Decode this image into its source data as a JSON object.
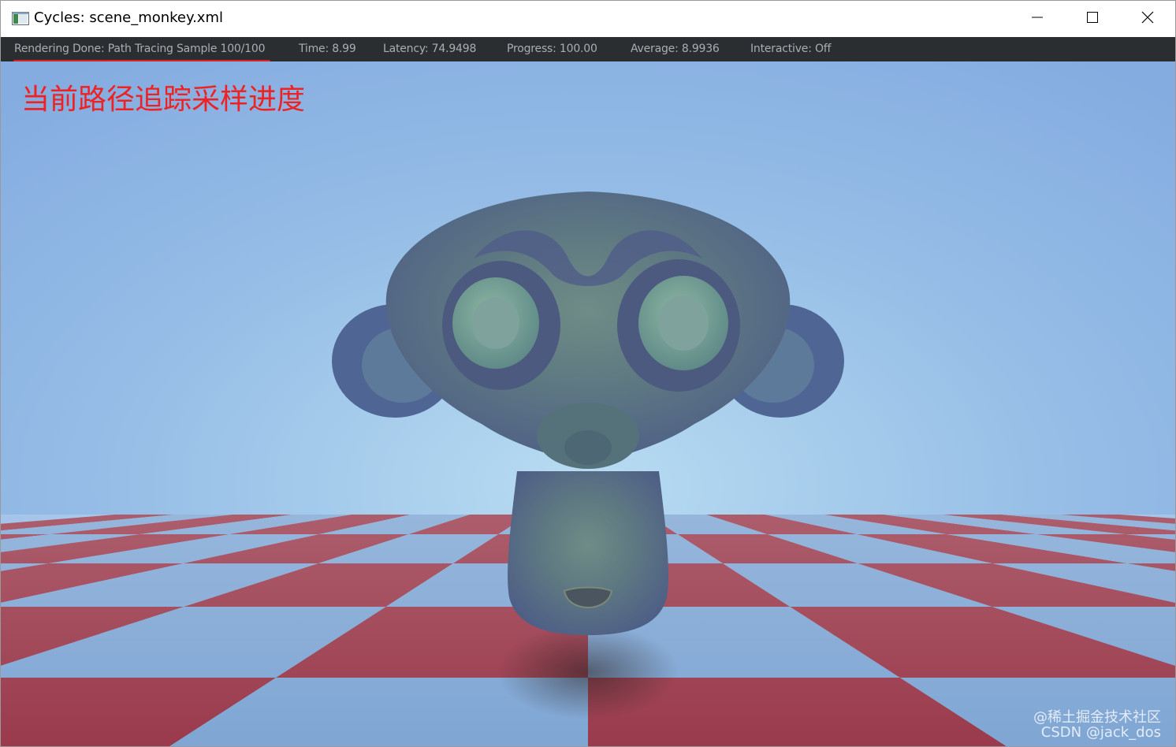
{
  "window": {
    "title": "Cycles: scene_monkey.xml",
    "icon": "app-window-icon",
    "controls": {
      "minimize": "minimize-icon",
      "maximize": "maximize-icon",
      "close": "close-icon"
    }
  },
  "status_bar": {
    "status": "Rendering Done: Path Tracing Sample 100/100",
    "time": "Time: 8.99",
    "latency": "Latency: 74.9498",
    "progress": "Progress: 100.00",
    "average": "Average: 8.9936",
    "interactive": "Interactive: Off",
    "highlight_color": "#e02020"
  },
  "annotation": {
    "text": "当前路径追踪采样进度",
    "color": "#ee2222"
  },
  "render": {
    "sky_color": "#8cb4e4",
    "checker_red": "#9a3a4c",
    "checker_blue": "#7fa6d4"
  },
  "watermark": {
    "line1": "@稀土掘金技术社区",
    "line2": "CSDN @jack_dos"
  }
}
